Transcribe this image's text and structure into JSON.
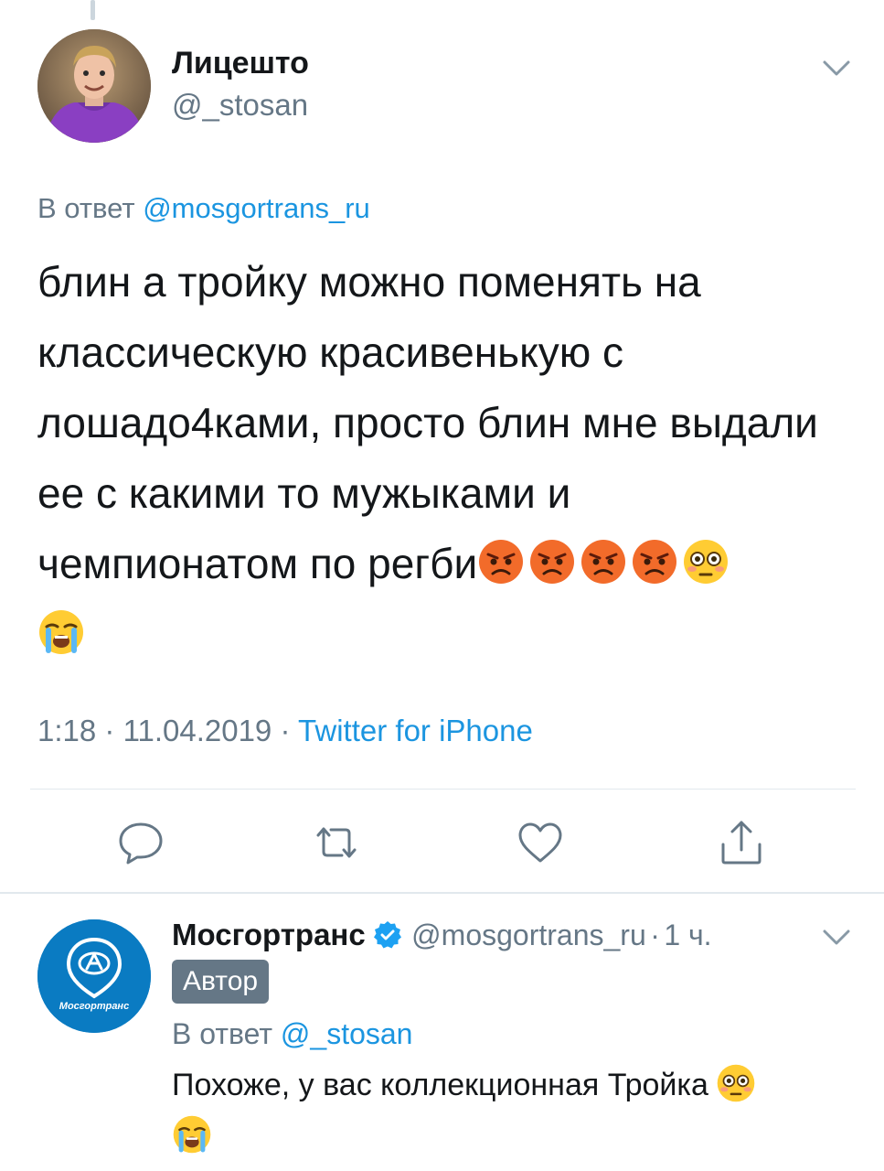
{
  "main_tweet": {
    "display_name": "Лицешто",
    "handle": "@_stosan",
    "reply_prefix": "В ответ",
    "reply_mention": "@mosgortrans_ru",
    "text": "блин а тройку можно поменять на классическую красивенькую с лошадо4ками, просто блин мне выдали ее с какими то мужыками и чемпионатом по регби",
    "emojis": [
      "angry-face",
      "angry-face",
      "angry-face",
      "angry-face",
      "flushed-face",
      "crying-face"
    ],
    "time": "1:18",
    "separator": "·",
    "date": "11.04.2019",
    "source": "Twitter for iPhone",
    "actions": [
      "reply-icon",
      "retweet-icon",
      "like-icon",
      "share-icon"
    ]
  },
  "reply_tweet": {
    "display_name": "Мосгортранс",
    "handle": "@mosgortrans_ru",
    "separator": "·",
    "time_ago": "1 ч.",
    "author_badge": "Автор",
    "reply_prefix": "В ответ",
    "reply_mention": "@_stosan",
    "text": "Похоже, у вас коллекционная Тройка",
    "emojis": [
      "flushed-face",
      "crying-face"
    ],
    "avatar_text": "Мосгортранс"
  },
  "colors": {
    "link_blue": "#1b95e0",
    "gray_text": "#657786",
    "text": "#14171a",
    "divider": "#e1e8ed",
    "brand_blue": "#0a7bc2"
  }
}
